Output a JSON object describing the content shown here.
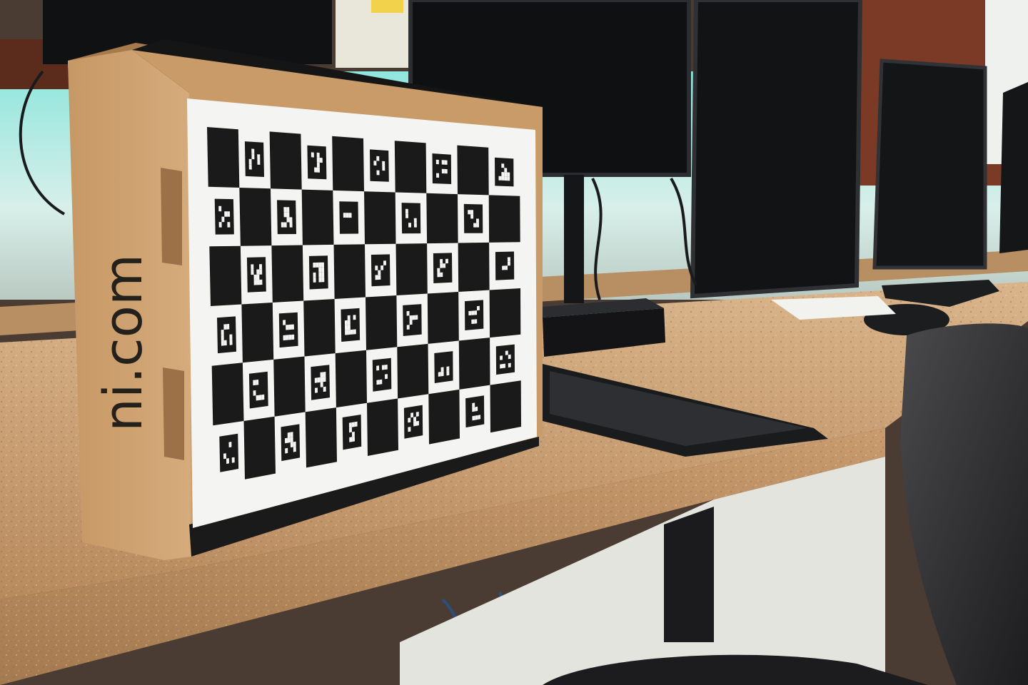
{
  "photo": {
    "box_label": "ni.com",
    "board": {
      "rows": 6,
      "cols": 10,
      "square_color": "#1a1a1a",
      "paper_color": "#f4f5f2",
      "marker_type": "ChArUco"
    },
    "palette": {
      "wall_glow": "#5fd7cf",
      "countertop": "#c79a6e",
      "cardboard": "#c89a68",
      "monitor": "#111214",
      "chair": "#2c2c2e"
    }
  }
}
